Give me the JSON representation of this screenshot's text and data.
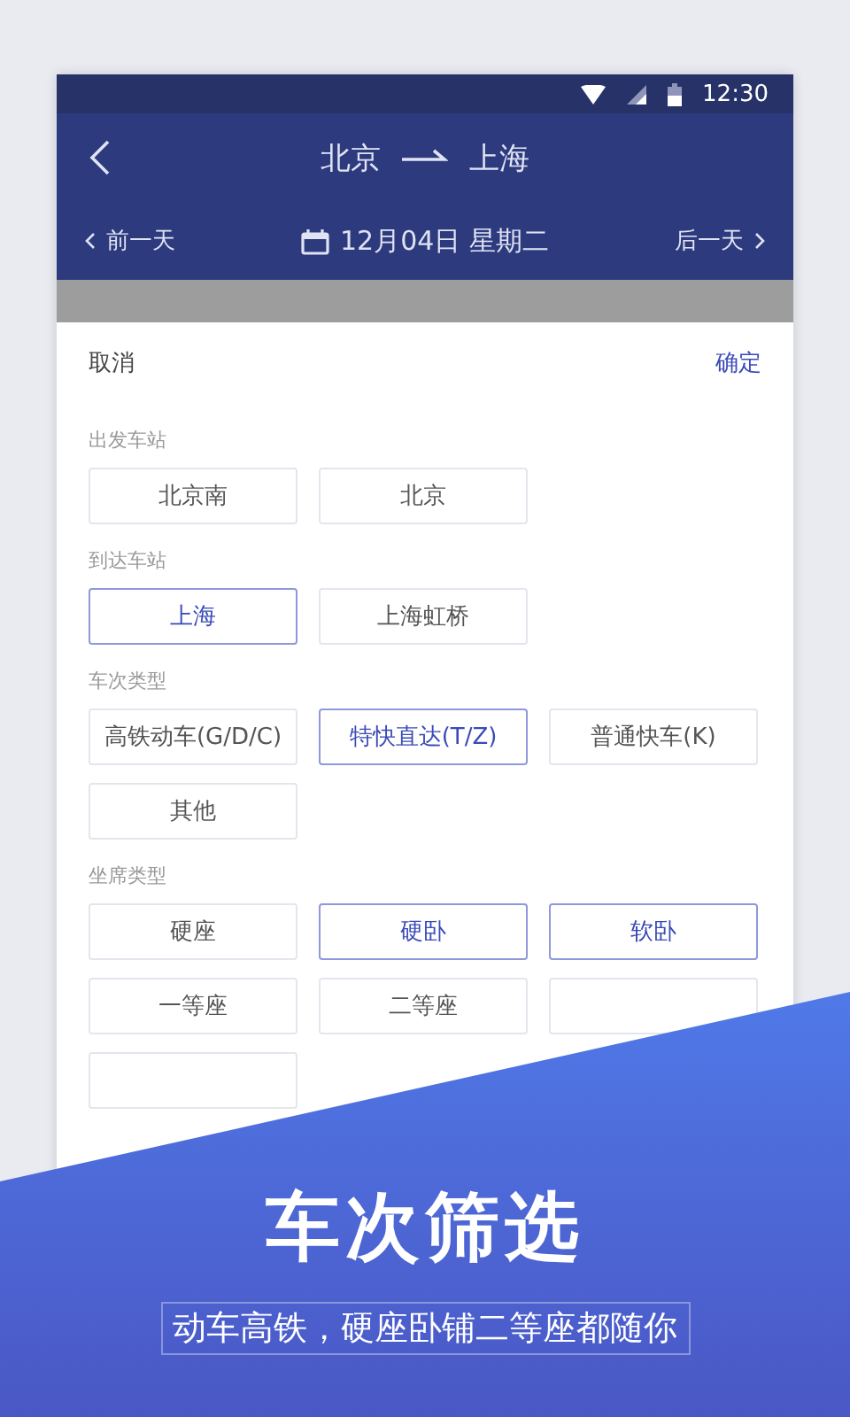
{
  "status_bar": {
    "time": "12:30"
  },
  "header": {
    "from": "北京",
    "to": "上海",
    "prev_day": "前一天",
    "date": "12月04日 星期二",
    "next_day": "后一天"
  },
  "sheet": {
    "cancel": "取消",
    "confirm": "确定",
    "sections": [
      {
        "title": "出发车站",
        "options": [
          {
            "label": "北京南",
            "selected": false
          },
          {
            "label": "北京",
            "selected": false
          }
        ]
      },
      {
        "title": "到达车站",
        "options": [
          {
            "label": "上海",
            "selected": true
          },
          {
            "label": "上海虹桥",
            "selected": false
          }
        ]
      },
      {
        "title": "车次类型",
        "options": [
          {
            "label": "高铁动车(G/D/C)",
            "selected": false
          },
          {
            "label": "特快直达(T/Z)",
            "selected": true
          },
          {
            "label": "普通快车(K)",
            "selected": false
          },
          {
            "label": "其他",
            "selected": false
          }
        ]
      },
      {
        "title": "坐席类型",
        "options": [
          {
            "label": "硬座",
            "selected": false
          },
          {
            "label": "硬卧",
            "selected": true
          },
          {
            "label": "软卧",
            "selected": true
          },
          {
            "label": "一等座",
            "selected": false
          },
          {
            "label": "二等座",
            "selected": false
          }
        ]
      }
    ]
  },
  "promo": {
    "title": "车次筛选",
    "subtitle": "动车高铁，硬座卧铺二等座都随你"
  }
}
